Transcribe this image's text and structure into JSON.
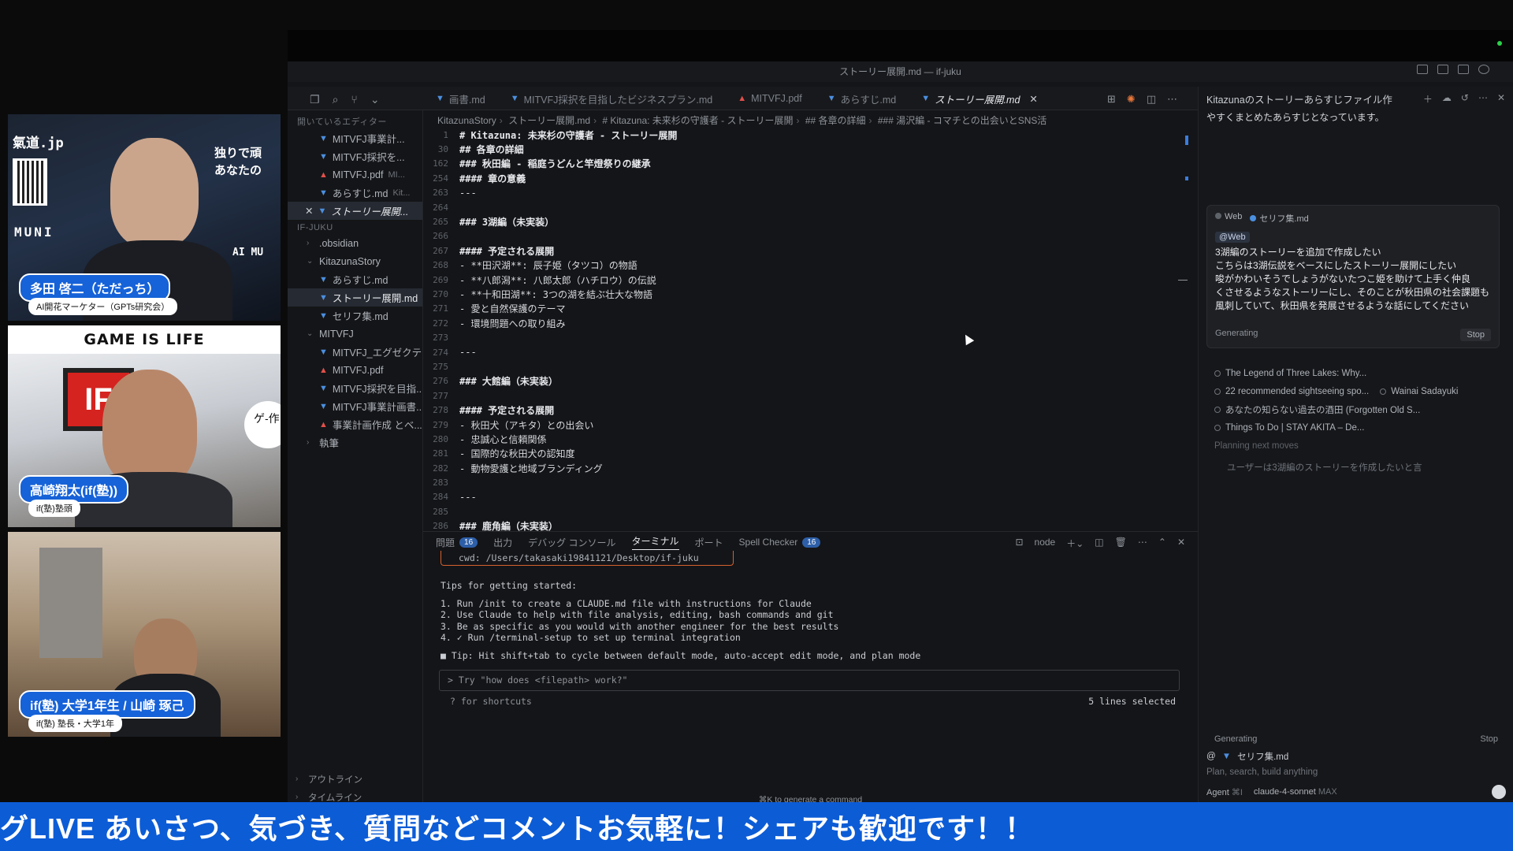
{
  "window": {
    "title": "ストーリー展開.md — if-juku"
  },
  "tabs": [
    {
      "label": "画書.md",
      "icon": "markdown-icon"
    },
    {
      "label": "MITVFJ採択を目指したビジネスプラン.md",
      "icon": "markdown-icon"
    },
    {
      "label": "MITVFJ.pdf",
      "icon": "pdf-icon"
    },
    {
      "label": "あらすじ.md",
      "icon": "markdown-icon"
    },
    {
      "label": "ストーリー展開.md",
      "icon": "markdown-icon",
      "active": true
    }
  ],
  "sidebar": {
    "open_editors_title": "開いているエディター",
    "open_editors": [
      {
        "label": "MITVFJ事業計...",
        "icon": "markdown-icon"
      },
      {
        "label": "MITVFJ採択を...",
        "icon": "markdown-icon"
      },
      {
        "label": "MITVFJ.pdf",
        "desc": "MI...",
        "icon": "pdf-icon"
      },
      {
        "label": "あらすじ.md",
        "desc": "Kit...",
        "icon": "markdown-icon"
      },
      {
        "label": "ストーリー展開...",
        "icon": "markdown-icon"
      }
    ],
    "workspace_title": "IF-JUKU",
    "tree": [
      {
        "label": ".obsidian",
        "type": "folder"
      },
      {
        "label": "KitazunaStory",
        "type": "folder-open"
      },
      {
        "label": "あらすじ.md",
        "type": "md"
      },
      {
        "label": "ストーリー展開.md",
        "type": "md",
        "selected": true
      },
      {
        "label": "セリフ集.md",
        "type": "md"
      },
      {
        "label": "MITVFJ",
        "type": "folder-open"
      },
      {
        "label": "MITVFJ_エグゼクテ...",
        "type": "md"
      },
      {
        "label": "MITVFJ.pdf",
        "type": "pdf"
      },
      {
        "label": "MITVFJ採択を目指...",
        "type": "md"
      },
      {
        "label": "MITVFJ事業計画書...",
        "type": "md"
      },
      {
        "label": "事業計画作成 とベ...",
        "type": "pdf"
      },
      {
        "label": "執筆",
        "type": "folder"
      }
    ],
    "outline": "アウトライン",
    "timeline": "タイムライン"
  },
  "breadcrumb": [
    "KitazunaStory",
    "ストーリー展開.md",
    "# Kitazuna: 未来杉の守護者 - ストーリー展開",
    "## 各章の詳細",
    "### 湯沢編 - コマチとの出会いとSNS活"
  ],
  "editor": {
    "lines": [
      {
        "n": "1",
        "text": "# Kitazuna: 未来杉の守護者 - ストーリー展開",
        "bold": true
      },
      {
        "n": "30",
        "text": "## 各章の詳細",
        "bold": true
      },
      {
        "n": "162",
        "text": "### 秋田編 - 稲庭うどんと竿燈祭りの継承",
        "bold": true
      },
      {
        "n": "254",
        "text": "#### 章の意義",
        "bold": true
      },
      {
        "n": "263",
        "text": "---"
      },
      {
        "n": "264",
        "text": ""
      },
      {
        "n": "265",
        "text": "### 3湖編（未実装）",
        "bold": true
      },
      {
        "n": "266",
        "text": ""
      },
      {
        "n": "267",
        "text": "#### 予定される展開",
        "bold": true
      },
      {
        "n": "268",
        "text": "- **田沢湖**: 辰子姫（タツコ）の物語"
      },
      {
        "n": "269",
        "text": "- **八郎潟**: 八郎太郎（ハチロウ）の伝説"
      },
      {
        "n": "270",
        "text": "- **十和田湖**: 3つの湖を結ぶ壮大な物語"
      },
      {
        "n": "271",
        "text": "- 愛と自然保護のテーマ"
      },
      {
        "n": "272",
        "text": "- 環境問題への取り組み"
      },
      {
        "n": "273",
        "text": ""
      },
      {
        "n": "274",
        "text": "---"
      },
      {
        "n": "275",
        "text": ""
      },
      {
        "n": "276",
        "text": "### 大館編（未実装）",
        "bold": true
      },
      {
        "n": "277",
        "text": ""
      },
      {
        "n": "278",
        "text": "#### 予定される展開",
        "bold": true
      },
      {
        "n": "279",
        "text": "- 秋田犬（アキタ）との出会い"
      },
      {
        "n": "280",
        "text": "- 忠誠心と信頼関係"
      },
      {
        "n": "281",
        "text": "- 国際的な秋田犬の認知度"
      },
      {
        "n": "282",
        "text": "- 動物愛護と地域ブランディング"
      },
      {
        "n": "283",
        "text": ""
      },
      {
        "n": "284",
        "text": "---"
      },
      {
        "n": "285",
        "text": ""
      },
      {
        "n": "286",
        "text": "### 鹿角編（未実装）",
        "bold": true
      }
    ]
  },
  "panel": {
    "tabs": [
      {
        "label": "問題",
        "badge": "16"
      },
      {
        "label": "出力"
      },
      {
        "label": "デバッグ コンソール"
      },
      {
        "label": "ターミナル",
        "active": true
      },
      {
        "label": "ポート"
      },
      {
        "label": "Spell Checker",
        "badge": "16"
      }
    ],
    "terminal_name": "node",
    "cwd": "cwd: /Users/takasaki19841121/Desktop/if-juku",
    "tips_title": "Tips for getting started:",
    "tips": [
      "1. Run /init to create a CLAUDE.md file with instructions for Claude",
      "2. Use Claude to help with file analysis, editing, bash commands and git",
      "3. Be as specific as you would with another engineer for the best results",
      "4. ✓ Run /terminal-setup to set up terminal integration"
    ],
    "tip_line": "■ Tip: Hit shift+tab to cycle between default mode, auto-accept edit mode, and plan mode",
    "prompt_placeholder": "> Try \"how does <filepath> work?\"",
    "shortcuts": "? for shortcuts",
    "selected": "5 lines selected",
    "generate_hint": "⌘K to generate a command"
  },
  "chat": {
    "title": "Kitazunaのストーリーあらすじファイル作",
    "intro": "やすくまとめたあらすじとなっています。",
    "chips": [
      "Web",
      "セリフ集.md"
    ],
    "web_tag": "@Web",
    "message": [
      "3湖編のストーリーを追加で作成したい",
      "こちらは3湖伝説をベースにしたストーリー展開にしたい",
      "唆がかわいそうでしょうがないたつこ姫を助けて上手く仲良",
      "くさせるようなストーリーにし、そのことが秋田県の社会課題も",
      "風刺していて、秋田県を発展させるような話にしてください"
    ],
    "generating": "Generating",
    "stop": "Stop",
    "results": [
      "The Legend of Three Lakes: Why...",
      "22 recommended sightseeing spo...",
      "あなたの知らない過去の酒田 (Forgotten Old S...",
      "Things To Do | STAY AKITA – De..."
    ],
    "result_extra": "Wainai Sadayuki",
    "planning": "Planning next moves",
    "thought": "ユーザーは3湖編のストーリーを作成したいと言",
    "generating2": "Generating",
    "composer_file": "セリフ集.md",
    "composer_placeholder": "Plan, search, build anything",
    "agent": "Agent",
    "agent_key": "⌘I",
    "model": "claude-4-sonnet",
    "model_tag": "MAX"
  },
  "cams": {
    "cam1": {
      "name": "多田 啓二（ただっち）",
      "sub": "AI開花マーケター（GPTs研究会）",
      "brand": "氣道.jp",
      "brand2": "MUNI",
      "overlay": "独りで頑",
      "overlay2": "あなたの",
      "brand3": "AI MU"
    },
    "cam2": {
      "banner": "GAME IS LIFE",
      "name": "高崎翔太(if(塾))",
      "sub": "if(塾)塾頭",
      "logo": "IF",
      "bubble": "ゲ-作っ"
    },
    "cam3": {
      "name": "if(塾) 大学1年生 / 山崎 琢己",
      "sub": "if(塾) 塾長・大学1年"
    }
  },
  "ticker": "グLIVE あいさつ、気づき、質問などコメントお気軽に！シェアも歓迎です！！"
}
